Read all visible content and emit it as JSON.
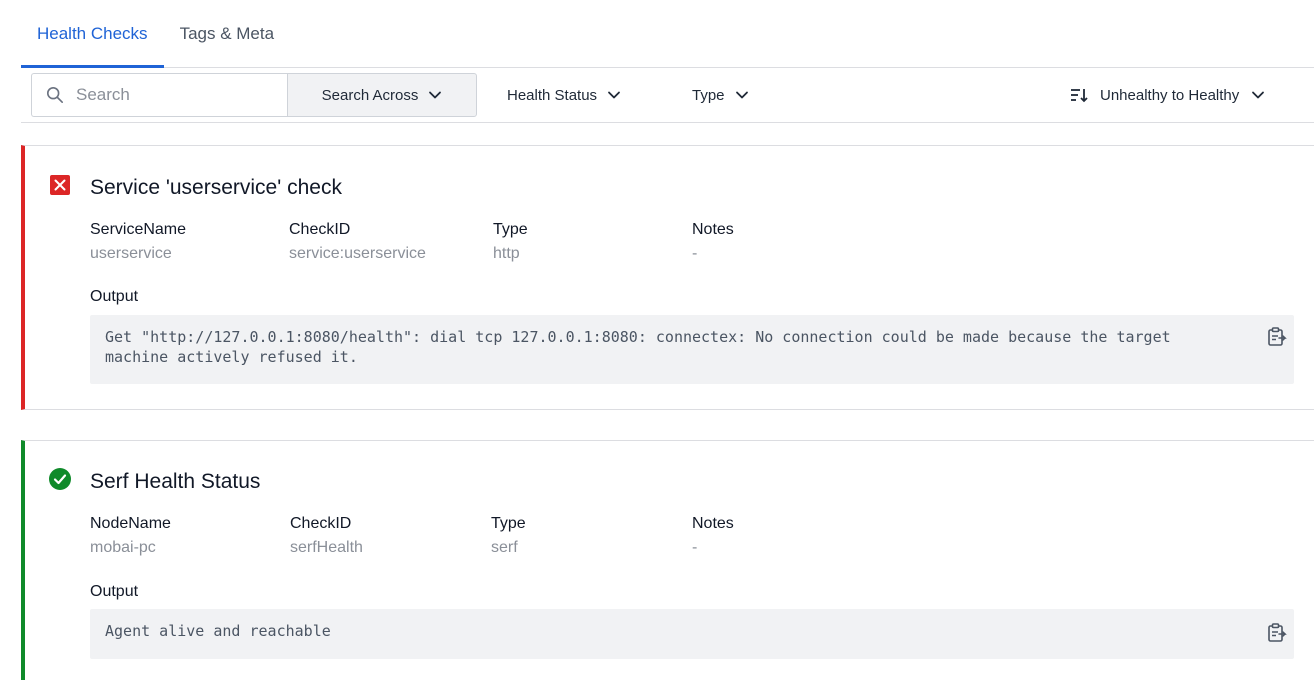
{
  "tabs": [
    {
      "label": "Health Checks",
      "active": true
    },
    {
      "label": "Tags & Meta",
      "active": false
    }
  ],
  "toolbar": {
    "search_placeholder": "Search",
    "search_across_label": "Search Across",
    "health_status_label": "Health Status",
    "type_label": "Type",
    "sort_label": "Unhealthy to Healthy"
  },
  "colors": {
    "accent": "#1f63d6",
    "critical": "#dc2626",
    "passing": "#0f8a2a"
  },
  "checks": [
    {
      "status": "critical",
      "status_icon": "x-square-icon",
      "title": "Service 'userservice' check",
      "fields": [
        {
          "label": "ServiceName",
          "value": "userservice"
        },
        {
          "label": "CheckID",
          "value": "service:userservice"
        },
        {
          "label": "Type",
          "value": "http"
        },
        {
          "label": "Notes",
          "value": "-"
        }
      ],
      "output_label": "Output",
      "output": "Get \"http://127.0.0.1:8080/health\": dial tcp 127.0.0.1:8080: connectex: No connection could be made because the target machine actively refused it."
    },
    {
      "status": "passing",
      "status_icon": "check-circle-icon",
      "title": "Serf Health Status",
      "fields": [
        {
          "label": "NodeName",
          "value": "mobai-pc"
        },
        {
          "label": "CheckID",
          "value": "serfHealth"
        },
        {
          "label": "Type",
          "value": "serf"
        },
        {
          "label": "Notes",
          "value": "-"
        }
      ],
      "output_label": "Output",
      "output": "Agent alive and reachable"
    }
  ]
}
